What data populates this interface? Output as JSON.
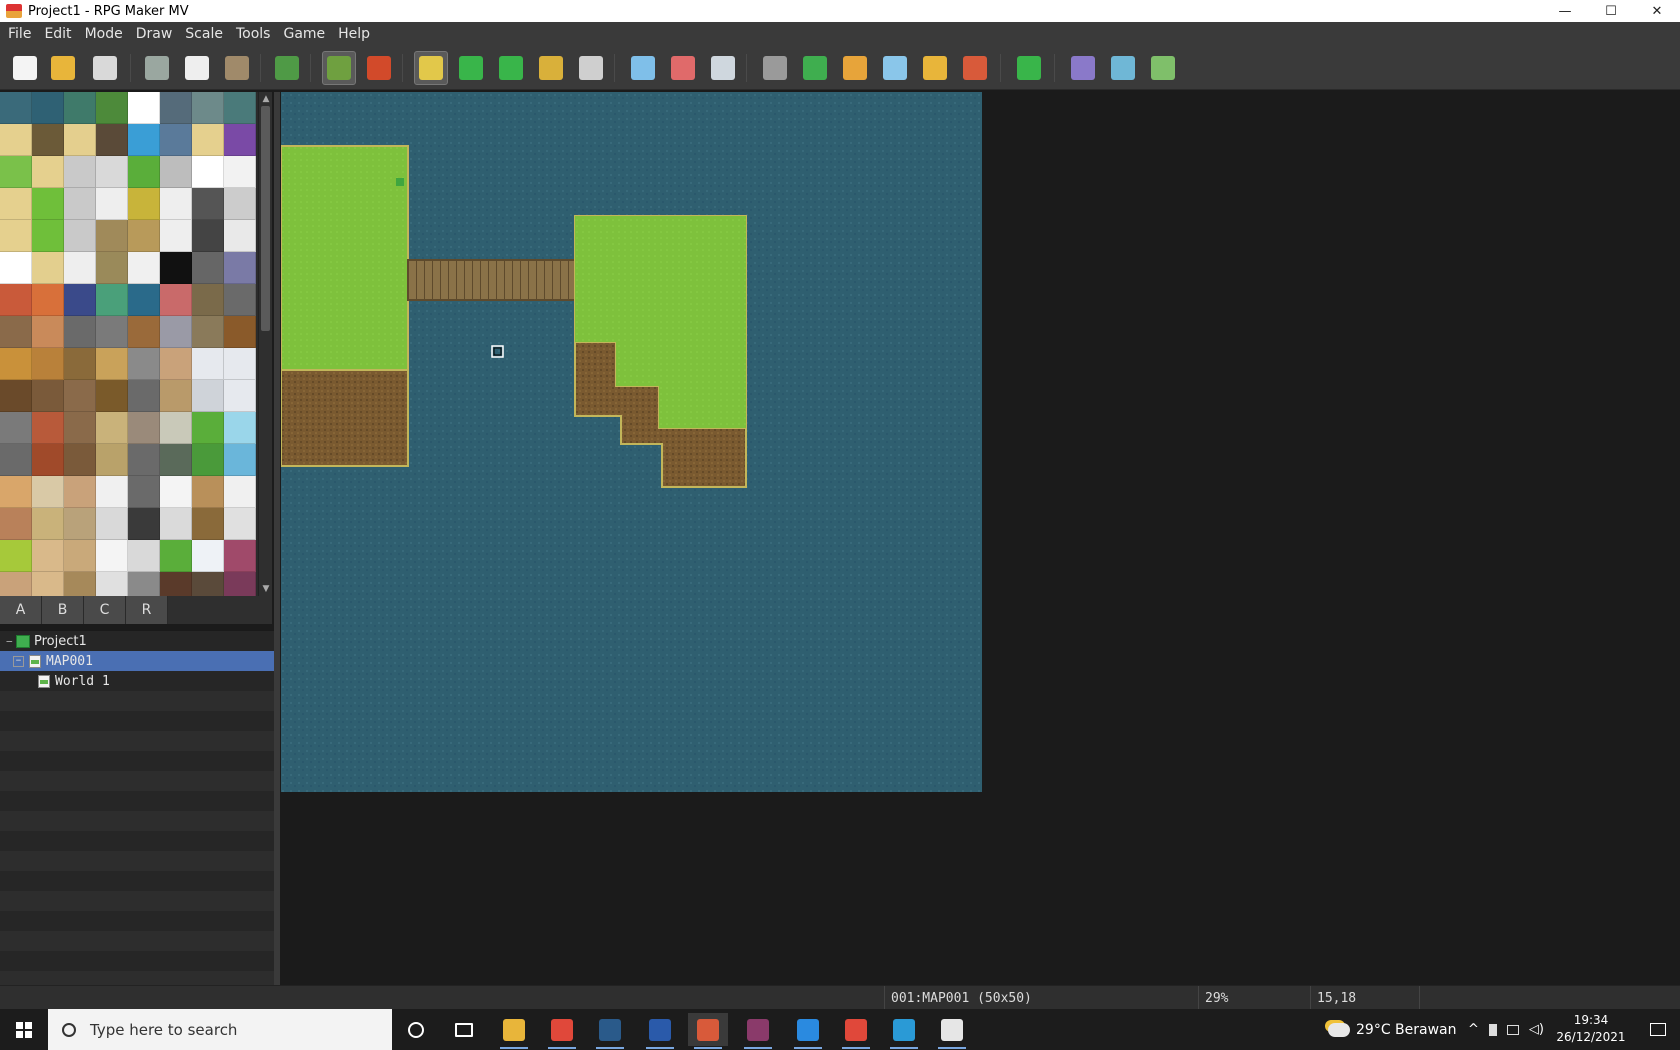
{
  "window": {
    "title": "Project1 - RPG Maker MV",
    "minimize": "—",
    "maximize": "☐",
    "close": "✕"
  },
  "menu": [
    "File",
    "Edit",
    "Mode",
    "Draw",
    "Scale",
    "Tools",
    "Game",
    "Help"
  ],
  "toolbar": {
    "buttons": [
      {
        "name": "new-project",
        "color": "#f4f4f4"
      },
      {
        "name": "open-project",
        "color": "#e8b53a"
      },
      {
        "name": "save-project",
        "color": "#d9d9d9"
      },
      {
        "name": "cut",
        "color": "#9aa7a0"
      },
      {
        "name": "copy",
        "color": "#eeeeee"
      },
      {
        "name": "paste",
        "color": "#a08a6a"
      },
      {
        "name": "undo",
        "color": "#4f9a46"
      },
      {
        "name": "map-mode",
        "color": "#6fa040",
        "active": true
      },
      {
        "name": "event-mode",
        "color": "#d24a2a"
      },
      {
        "name": "pencil",
        "color": "#e2c84a",
        "active": true
      },
      {
        "name": "rectangle",
        "color": "#39b54a"
      },
      {
        "name": "ellipse",
        "color": "#39b54a"
      },
      {
        "name": "flood-fill",
        "color": "#d9b03a"
      },
      {
        "name": "shadow-pen",
        "color": "#cfcfcf"
      },
      {
        "name": "zoom-in",
        "color": "#7fbfe9"
      },
      {
        "name": "zoom-out",
        "color": "#e06a6a"
      },
      {
        "name": "actual-size",
        "color": "#cfd7de"
      },
      {
        "name": "database",
        "color": "#9a9a9a"
      },
      {
        "name": "plugin-manager",
        "color": "#3fae4f"
      },
      {
        "name": "sound-test",
        "color": "#e7a43a"
      },
      {
        "name": "event-searcher",
        "color": "#8ac6ea"
      },
      {
        "name": "resource-manager",
        "color": "#e8b53a"
      },
      {
        "name": "character-generator",
        "color": "#d85a3a"
      },
      {
        "name": "playtest",
        "color": "#39b54a"
      },
      {
        "name": "deploy",
        "color": "#8a79c9"
      },
      {
        "name": "steam-management",
        "color": "#6fb7d6"
      },
      {
        "name": "open-project-folder",
        "color": "#7fbf6a"
      }
    ]
  },
  "tileset": {
    "tabs": [
      "A",
      "B",
      "C",
      "R"
    ],
    "tile_colors": [
      "#3a6a7a",
      "#2f6174",
      "#3f7a6a",
      "#4d8a3a",
      "#ffffff",
      "#556b7a",
      "#6d8a8a",
      "#4a7a7a",
      "#e5d08e",
      "#6b5a38",
      "#e4cf8e",
      "#5a4a38",
      "#3a9ed6",
      "#5a7a9a",
      "#e5d08e",
      "#7a4aa6",
      "#7ac14a",
      "#e5d08e",
      "#c9c9c9",
      "#d9d9d9",
      "#5aae3a",
      "#bdbdbd",
      "#ffffff",
      "#f2f2f2",
      "#e5d08e",
      "#6fbf3a",
      "#c9c9c9",
      "#eeeeee",
      "#c8b43a",
      "#eeeeee",
      "#555555",
      "#cccccc",
      "#e5d08e",
      "#6fbf3a",
      "#c9c9c9",
      "#a08a5a",
      "#b89a5a",
      "#eeeeee",
      "#444444",
      "#e9e9e9",
      "#ffffff",
      "#e3cf8e",
      "#eeeeee",
      "#9a8a5a",
      "#f0f0f0",
      "#111111",
      "#666666",
      "#7a7aa6",
      "#c95a3a",
      "#d8703a",
      "#3a4a8a",
      "#4aa07a",
      "#2a6a8a",
      "#c96a6a",
      "#7a6a4a",
      "#6a6a6a",
      "#8a6a4a",
      "#c98a5a",
      "#6a6a6a",
      "#7a7a7a",
      "#9a6a3a",
      "#9a9aa6",
      "#8a7a5a",
      "#8a5a2a",
      "#c9913a",
      "#b9813a",
      "#8a6a3a",
      "#c9a25a",
      "#8a8a8a",
      "#c9a27a",
      "#e6e9ee",
      "#e6e9ee",
      "#6a4a2a",
      "#7a5a3a",
      "#8a6a4a",
      "#7a5a2a",
      "#6a6a6a",
      "#b99a6a",
      "#cfd3d9",
      "#e6e9ee",
      "#7a7a7a",
      "#b85a3a",
      "#8a6a4a",
      "#c9b27a",
      "#9a8a7a",
      "#c9c9b9",
      "#5aae3a",
      "#9ad6ea",
      "#6a6a6a",
      "#a04a2a",
      "#7a5a3a",
      "#b9a26a",
      "#6a6a6a",
      "#5a6a5a",
      "#4a9a3a",
      "#6ab6da",
      "#d9a66a",
      "#d9c9a6",
      "#c9a27a",
      "#f0f0f0",
      "#6a6a6a",
      "#f4f4f4",
      "#b9905a",
      "#f0f0f0",
      "#b9815a",
      "#c9b27a",
      "#b9a27a",
      "#d9d9d9",
      "#3a3a3a",
      "#dadada",
      "#8a6a3a",
      "#e0e0e0",
      "#a6c93a",
      "#d9b98a",
      "#c9a97a",
      "#f4f4f4",
      "#d9d9d9",
      "#5aae3a",
      "#eef2f6",
      "#a04a6a",
      "#c9a27a",
      "#d9b98a",
      "#a6895a",
      "#e0e0e0",
      "#8a8a8a",
      "#5a3a2a",
      "#5a4a3a",
      "#7a3a5a"
    ]
  },
  "tree": {
    "project": "Project1",
    "maps": [
      {
        "label": "MAP001",
        "selected": true
      },
      {
        "label": "World 1",
        "selected": false
      }
    ],
    "collapse_symbol": "−"
  },
  "map": {
    "name": "MAP001",
    "water_color": "#2f5f70",
    "grass_color": "#7ec13c",
    "dirt_color": "#7a5a30",
    "bridge_color": "#8a7248"
  },
  "status": {
    "map_info": "001:MAP001 (50x50)",
    "zoom": "29%",
    "coords": "15,18"
  },
  "taskbar": {
    "search_placeholder": "Type here to search",
    "apps": [
      {
        "name": "cortana",
        "color": "#ffffff"
      },
      {
        "name": "task-view",
        "color": "#ffffff"
      },
      {
        "name": "file-explorer",
        "color": "#e8b53a"
      },
      {
        "name": "chrome",
        "color": "#e0483a"
      },
      {
        "name": "steam",
        "color": "#2a5a8a"
      },
      {
        "name": "word",
        "color": "#2a5aaa"
      },
      {
        "name": "rpg-maker-mv",
        "color": "#d85a3a"
      },
      {
        "name": "winrar",
        "color": "#8a3a6a"
      },
      {
        "name": "vscode",
        "color": "#2a8ae0"
      },
      {
        "name": "chrome-profile",
        "color": "#e0483a"
      },
      {
        "name": "edge",
        "color": "#2a9ad6"
      },
      {
        "name": "paint",
        "color": "#e6e6e6"
      }
    ],
    "weather": "29°C  Berawan",
    "time": "19:34",
    "date": "26/12/2021"
  }
}
